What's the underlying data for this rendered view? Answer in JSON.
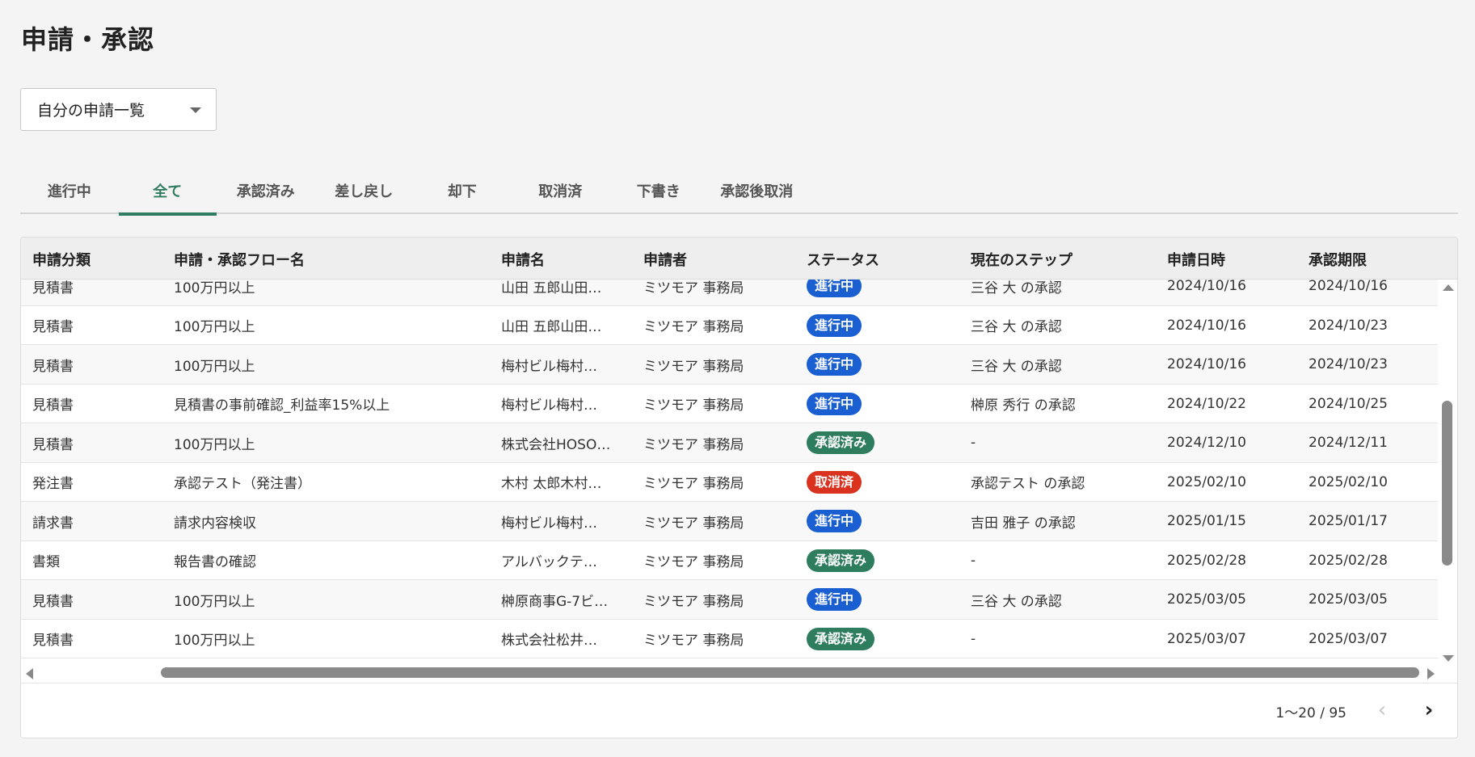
{
  "page": {
    "title": "申請・承認"
  },
  "filter": {
    "selected": "自分の申請一覧"
  },
  "tabs": [
    {
      "label": "進行中",
      "active": false
    },
    {
      "label": "全て",
      "active": true
    },
    {
      "label": "承認済み",
      "active": false
    },
    {
      "label": "差し戻し",
      "active": false
    },
    {
      "label": "却下",
      "active": false
    },
    {
      "label": "取消済",
      "active": false
    },
    {
      "label": "下書き",
      "active": false
    },
    {
      "label": "承認後取消",
      "active": false
    }
  ],
  "table": {
    "columns": [
      "申請分類",
      "申請・承認フロー名",
      "申請名",
      "申請者",
      "ステータス",
      "現在のステップ",
      "申請日時",
      "承認期限"
    ],
    "rows": [
      {
        "category": "見積書",
        "flow": "100万円以上",
        "name": "山田 五郎山田…",
        "applicant": "ミツモア 事務局",
        "status": "進行中",
        "step": "三谷 大 の承認",
        "applied": "2024/10/16",
        "deadline": "2024/10/16"
      },
      {
        "category": "見積書",
        "flow": "100万円以上",
        "name": "山田 五郎山田…",
        "applicant": "ミツモア 事務局",
        "status": "進行中",
        "step": "三谷 大 の承認",
        "applied": "2024/10/16",
        "deadline": "2024/10/23"
      },
      {
        "category": "見積書",
        "flow": "100万円以上",
        "name": "梅村ビル梅村…",
        "applicant": "ミツモア 事務局",
        "status": "進行中",
        "step": "三谷 大 の承認",
        "applied": "2024/10/16",
        "deadline": "2024/10/23"
      },
      {
        "category": "見積書",
        "flow": "見積書の事前確認_利益率15%以上",
        "name": "梅村ビル梅村…",
        "applicant": "ミツモア 事務局",
        "status": "進行中",
        "step": "榊原 秀行 の承認",
        "applied": "2024/10/22",
        "deadline": "2024/10/25"
      },
      {
        "category": "見積書",
        "flow": "100万円以上",
        "name": "株式会社HOSO…",
        "applicant": "ミツモア 事務局",
        "status": "承認済み",
        "step": "-",
        "applied": "2024/12/10",
        "deadline": "2024/12/11"
      },
      {
        "category": "発注書",
        "flow": "承認テスト（発注書）",
        "name": "木村 太郎木村…",
        "applicant": "ミツモア 事務局",
        "status": "取消済",
        "step": "承認テスト の承認",
        "applied": "2025/02/10",
        "deadline": "2025/02/10"
      },
      {
        "category": "請求書",
        "flow": "請求内容検収",
        "name": "梅村ビル梅村…",
        "applicant": "ミツモア 事務局",
        "status": "進行中",
        "step": "吉田 雅子 の承認",
        "applied": "2025/01/15",
        "deadline": "2025/01/17"
      },
      {
        "category": "書類",
        "flow": "報告書の確認",
        "name": "アルバックテ…",
        "applicant": "ミツモア 事務局",
        "status": "承認済み",
        "step": "-",
        "applied": "2025/02/28",
        "deadline": "2025/02/28"
      },
      {
        "category": "見積書",
        "flow": "100万円以上",
        "name": "榊原商事G-7ビ…",
        "applicant": "ミツモア 事務局",
        "status": "進行中",
        "step": "三谷 大 の承認",
        "applied": "2025/03/05",
        "deadline": "2025/03/05"
      },
      {
        "category": "見積書",
        "flow": "100万円以上",
        "name": "株式会社松井…",
        "applicant": "ミツモア 事務局",
        "status": "承認済み",
        "step": "-",
        "applied": "2025/03/07",
        "deadline": "2025/03/07"
      }
    ]
  },
  "status_colors": {
    "進行中": "#1a5fd1",
    "承認済み": "#2e7d5e",
    "取消済": "#d9321f"
  },
  "accent_color": "#2f7d5e",
  "pagination": {
    "range": "1〜20 / 95",
    "prev_icon": "chevron-left-icon",
    "next_icon": "chevron-right-icon"
  }
}
